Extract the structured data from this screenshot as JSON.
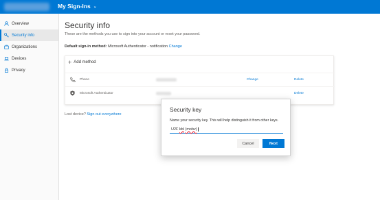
{
  "header": {
    "title": "My Sign-Ins",
    "chevron_icon": "chevron-down-icon",
    "color": "#0078d4"
  },
  "sidebar": {
    "items": [
      {
        "label": "Overview",
        "icon": "person-icon"
      },
      {
        "label": "Security info",
        "icon": "key-icon",
        "active": true
      },
      {
        "label": "Organizations",
        "icon": "briefcase-icon"
      },
      {
        "label": "Devices",
        "icon": "laptop-icon"
      },
      {
        "label": "Privacy",
        "icon": "lock-icon"
      }
    ]
  },
  "main": {
    "title": "Security info",
    "subtitle": "These are the methods you use to sign into your account or reset your password.",
    "default_label": "Default sign-in method:",
    "default_value": "Microsoft Authenticator - notification",
    "default_change": "Change",
    "add_method": "Add method",
    "methods": [
      {
        "name": "Phone",
        "icon": "phone-icon",
        "change": "Change",
        "delete": "Delete"
      },
      {
        "name": "Microsoft Authenticator",
        "icon": "authenticator-icon",
        "change": "",
        "delete": "Delete"
      }
    ],
    "lost_prefix": "Lost device?",
    "lost_link": "Sign out everywhere"
  },
  "dialog": {
    "title": "Security key",
    "text": "Name your security key. This will help distinguish it from other keys.",
    "input_prefix": "U2F",
    "input_word1": "kbl",
    "input_word2": "(mobv)",
    "cancel": "Cancel",
    "next": "Next"
  }
}
